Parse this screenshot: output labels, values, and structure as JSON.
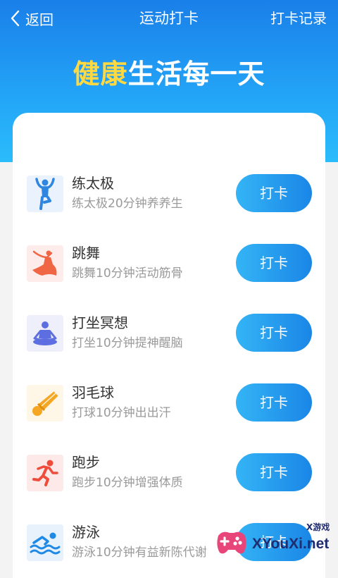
{
  "nav": {
    "back_label": "返回",
    "title": "运动打卡",
    "right_action": "打卡记录"
  },
  "headline": {
    "part1": "健康",
    "part2": "生活每一天",
    "part1_color": "#ffd942",
    "part2_color": "#ffffff"
  },
  "activities": [
    {
      "name": "练太极",
      "desc": "练太极20分钟养养生",
      "button": "打卡",
      "icon": "tai-chi-icon",
      "icon_color": "#2f86e0"
    },
    {
      "name": "跳舞",
      "desc": "跳舞10分钟活动筋骨",
      "button": "打卡",
      "icon": "dance-icon",
      "icon_color": "#f06543"
    },
    {
      "name": "打坐冥想",
      "desc": "打坐10分钟提神醒脑",
      "button": "打卡",
      "icon": "meditation-icon",
      "icon_color": "#5d6fe0"
    },
    {
      "name": "羽毛球",
      "desc": "打球10分钟出出汗",
      "button": "打卡",
      "icon": "badminton-icon",
      "icon_color": "#f5a623"
    },
    {
      "name": "跑步",
      "desc": "跑步10分钟增强体质",
      "button": "打卡",
      "icon": "running-icon",
      "icon_color": "#ee4d3c"
    },
    {
      "name": "游泳",
      "desc": "游泳10分钟有益新陈代谢",
      "button": "打卡",
      "icon": "swimming-icon",
      "icon_color": "#1e8ae6"
    }
  ],
  "watermark": {
    "text": "XYouXi.net",
    "subtext": "X游戏"
  },
  "colors": {
    "header_top": "#1a7fe9",
    "header_bottom": "#2bbcfb",
    "button_gradient_start": "#34b4f6",
    "button_gradient_end": "#1a86e6",
    "page_background": "#f3f3f3"
  }
}
